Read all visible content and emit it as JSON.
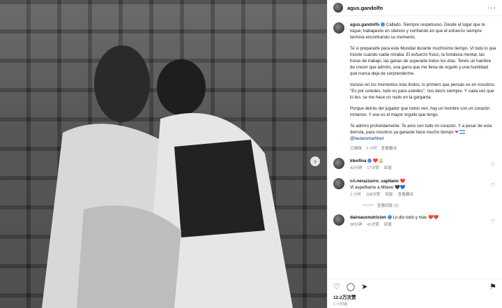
{
  "post": {
    "author": "agus.gandolfo",
    "caption_paragraphs": [
      "Callado. Siempre respetuoso. Desde el lugar que te toque, trabajando en silencio y confiando en que el esfuerzo siempre termina encontrando su momento.",
      "Te vi prepararte para este Mundial durante muchísimo tiempo. Vi todo lo que hiciste cuando nadie miraba. El esfuerzo físico, la fortaleza mental, las horas de trabajo, las ganas de superarte todos los días. Tenés un hambre de crecer que admiro, una garra que me llena de orgullo y una humildad que nunca deja de sorprenderme.",
      "Incluso en los momentos más lindos, lo primero que pensás es en nosotros. \"Es por ustedes, todo es para ustedes\", nos decís siempre. Y cada vez que lo leo, se me hace un nudo en la garganta.",
      "Porque detrás del jugador que todos ven, hay un hombre con un corazón inmenso. Y ese es el mayor orgullo que tengo."
    ],
    "final_paragraph": "Te admiro profundamente. Te amo con todo mi corazón. Y a pesar de esta derrota, para nosotros ya ganaste hace mucho tiempo",
    "mention": "@lautaromartinez",
    "edited_label": "已编辑",
    "caption_time": "1 小时",
    "translation_label": "查看翻译",
    "likes": "12.2万次赞",
    "post_time": "1 小时前"
  },
  "comments": [
    {
      "user": "kleofina",
      "verified": true,
      "text": "❤️🙏",
      "time": "43分钟",
      "likes": "17次赞",
      "reply": "回复",
      "show_replies": ""
    },
    {
      "user": "cri.nerazzurro_capitano",
      "verified": false,
      "text": "Vi aspettiamo a Milano 🖤💙",
      "prefix_heart": "❤️",
      "time": "1 小时",
      "likes": "108次赞",
      "reply": "回复",
      "translate": "查看翻译",
      "show_replies": "查看回复 (2)"
    },
    {
      "user": "daireauxnutricion",
      "verified": true,
      "text": "Lo dio todo y más ❤️❤️",
      "time": "38分钟",
      "likes": "41次赞",
      "reply": "回复",
      "show_replies": ""
    }
  ],
  "colors": {
    "verified": "#3897f0",
    "mention": "#00376b",
    "like": "#e0245e"
  }
}
